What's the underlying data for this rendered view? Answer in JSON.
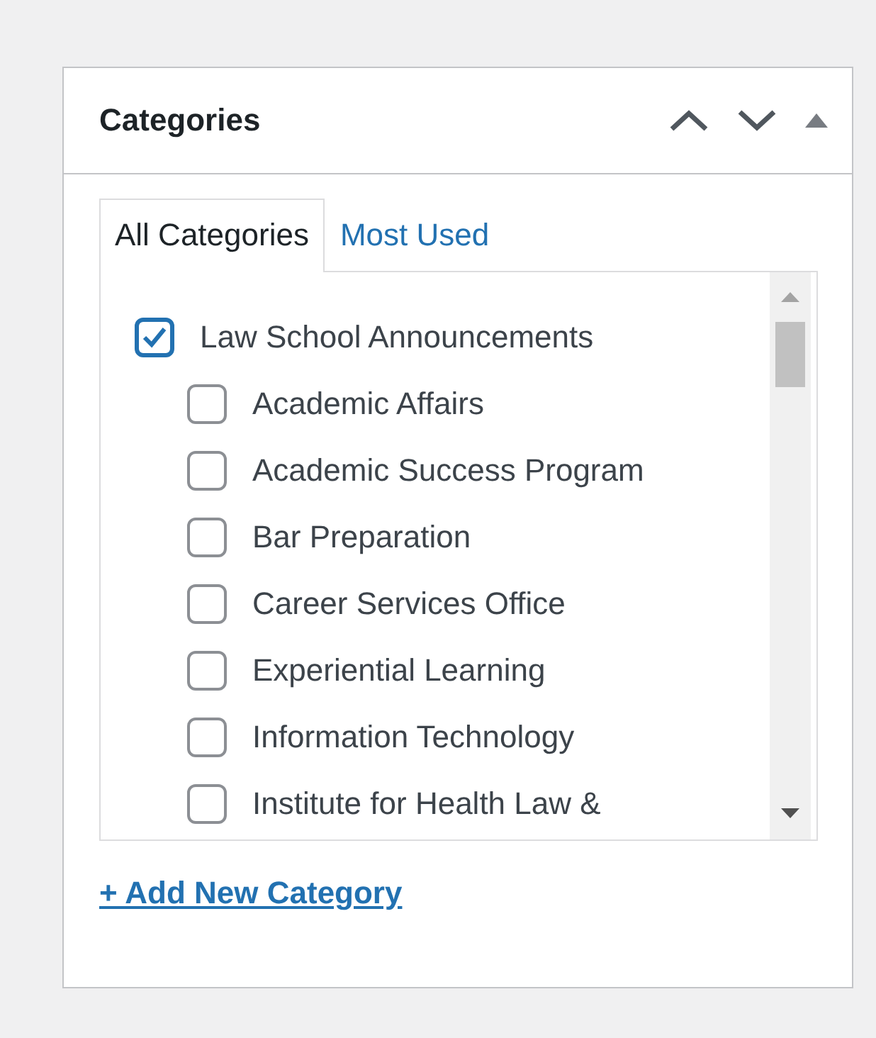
{
  "panel": {
    "title": "Categories"
  },
  "tabs": [
    {
      "label": "All Categories",
      "selected": true
    },
    {
      "label": "Most Used",
      "selected": false
    }
  ],
  "categories": [
    {
      "label": "Law School Announcements",
      "checked": true,
      "children": [
        {
          "label": "Academic Affairs",
          "checked": false
        },
        {
          "label": "Academic Success Program",
          "checked": false
        },
        {
          "label": "Bar Preparation",
          "checked": false
        },
        {
          "label": "Career Services Office",
          "checked": false
        },
        {
          "label": "Experiential Learning",
          "checked": false
        },
        {
          "label": "Information Technology",
          "checked": false
        },
        {
          "label": "Institute for Health Law &",
          "checked": false
        }
      ]
    }
  ],
  "add_link": "+ Add New Category"
}
